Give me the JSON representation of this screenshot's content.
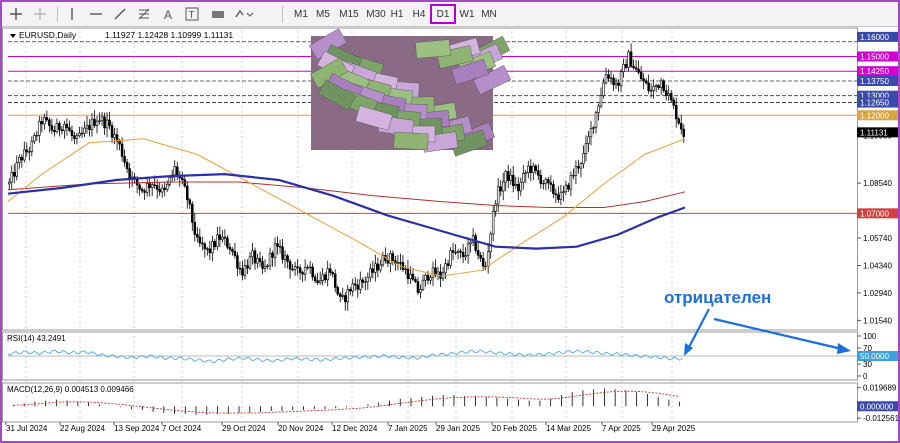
{
  "toolbar": {
    "timeframes": [
      "M1",
      "M5",
      "M15",
      "M30",
      "H1",
      "H4",
      "D1",
      "W1",
      "MN"
    ],
    "active_timeframe": "D1"
  },
  "colors": {
    "candle": "#000000",
    "ma_short": "#e6a040",
    "ma_mid": "#2b2fa8",
    "ma_long": "#b03030",
    "rsi": "#3ea0d8",
    "macd": "#000000",
    "signal": "#d03030",
    "level_magenta": "#d000d0",
    "level_gold": "#d6a640",
    "level_red": "#d04040",
    "annotation": "#1a6fe0",
    "accent": "#a349c4"
  },
  "chart_data": {
    "type": "candlestick",
    "title": "EURUSD,Daily",
    "ohlc_label": "1.11927 1.12428 1.10999 1.11131",
    "current_price": "1.11131",
    "ylim": [
      1.0105,
      1.163
    ],
    "price_ticks": [
      "1.16000",
      "1.13750",
      "1.13000",
      "1.12650",
      "1.10980",
      "1.08540",
      "1.05740",
      "1.04340",
      "1.02940",
      "1.01540"
    ],
    "level_labels": [
      "1.15000",
      "1.14250",
      "1.12000",
      "1.07000"
    ],
    "levels": [
      {
        "value": 1.15,
        "color": "magenta"
      },
      {
        "value": 1.1425,
        "color": "magenta"
      },
      {
        "value": 1.12,
        "color": "gold"
      },
      {
        "value": 1.07,
        "color": "red"
      }
    ],
    "dashed_levels": [
      1.1575,
      1.1375,
      1.13,
      1.1265
    ],
    "x_labels": [
      "31 Jul 2024",
      "22 Aug 2024",
      "13 Sep 2024",
      "7 Oct 2024",
      "29 Oct 2024",
      "20 Nov 2024",
      "12 Dec 2024",
      "7 Jan 2025",
      "29 Jan 2025",
      "20 Feb 2025",
      "14 Mar 2025",
      "7 Apr 2025",
      "29 Apr 2025"
    ],
    "close_path": [
      1.085,
      1.098,
      1.104,
      1.118,
      1.112,
      1.116,
      1.106,
      1.113,
      1.119,
      1.115,
      1.104,
      1.088,
      1.082,
      1.086,
      1.08,
      1.093,
      1.08,
      1.055,
      1.05,
      1.058,
      1.053,
      1.04,
      1.048,
      1.04,
      1.053,
      1.047,
      1.039,
      1.044,
      1.035,
      1.042,
      1.024,
      1.033,
      1.035,
      1.041,
      1.048,
      1.046,
      1.04,
      1.03,
      1.04,
      1.038,
      1.05,
      1.048,
      1.056,
      1.04,
      1.078,
      1.09,
      1.082,
      1.094,
      1.088,
      1.082,
      1.078,
      1.09,
      1.1,
      1.12,
      1.142,
      1.135,
      1.15,
      1.14,
      1.132,
      1.138,
      1.125,
      1.111
    ],
    "ma_short": [
      [
        0,
        1.076
      ],
      [
        0.05,
        1.09
      ],
      [
        0.12,
        1.106
      ],
      [
        0.2,
        1.108
      ],
      [
        0.28,
        1.1
      ],
      [
        0.36,
        1.085
      ],
      [
        0.44,
        1.07
      ],
      [
        0.52,
        1.055
      ],
      [
        0.58,
        1.043
      ],
      [
        0.64,
        1.038
      ],
      [
        0.7,
        1.041
      ],
      [
        0.76,
        1.055
      ],
      [
        0.82,
        1.068
      ],
      [
        0.88,
        1.085
      ],
      [
        0.94,
        1.1
      ],
      [
        1.0,
        1.108
      ]
    ],
    "ma_mid": [
      [
        0,
        1.08
      ],
      [
        0.08,
        1.083
      ],
      [
        0.16,
        1.087
      ],
      [
        0.24,
        1.089
      ],
      [
        0.32,
        1.09
      ],
      [
        0.4,
        1.087
      ],
      [
        0.48,
        1.079
      ],
      [
        0.56,
        1.069
      ],
      [
        0.64,
        1.061
      ],
      [
        0.72,
        1.053
      ],
      [
        0.78,
        1.052
      ],
      [
        0.84,
        1.053
      ],
      [
        0.9,
        1.059
      ],
      [
        0.96,
        1.068
      ],
      [
        1.0,
        1.073
      ]
    ],
    "ma_long": [
      [
        0,
        1.082
      ],
      [
        0.12,
        1.085
      ],
      [
        0.24,
        1.086
      ],
      [
        0.34,
        1.086
      ],
      [
        0.44,
        1.083
      ],
      [
        0.54,
        1.079
      ],
      [
        0.64,
        1.076
      ],
      [
        0.72,
        1.074
      ],
      [
        0.8,
        1.073
      ],
      [
        0.88,
        1.073
      ],
      [
        0.94,
        1.076
      ],
      [
        1.0,
        1.081
      ]
    ],
    "rsi": {
      "label": "RSI(14) 43.2491",
      "ticks": [
        "100",
        "70",
        "30",
        "0"
      ],
      "level_label": "50.0000",
      "ylim": [
        0,
        100
      ],
      "values": [
        55,
        60,
        57,
        62,
        58,
        60,
        52,
        48,
        46,
        50,
        45,
        44,
        40,
        36,
        42,
        45,
        40,
        38,
        44,
        42,
        40,
        44,
        46,
        48,
        50,
        46,
        45,
        52,
        55,
        60,
        62,
        58,
        55,
        52,
        54,
        58,
        62,
        60,
        56,
        54,
        50,
        48,
        44,
        43
      ]
    },
    "macd": {
      "label": "MACD(12,26,9) 0.004513 0.009466",
      "ticks": [
        "0.019689",
        "0.000000",
        "-0.012561"
      ],
      "ylim": [
        -0.0135,
        0.0215
      ],
      "hist": [
        0.001,
        0.003,
        0.005,
        0.006,
        0.007,
        0.006,
        0.005,
        0.004,
        0.002,
        0,
        -0.001,
        -0.003,
        -0.004,
        -0.006,
        -0.007,
        -0.008,
        -0.008,
        -0.009,
        -0.009,
        -0.008,
        -0.008,
        -0.007,
        -0.007,
        -0.006,
        -0.005,
        -0.005,
        -0.004,
        -0.004,
        -0.003,
        -0.003,
        -0.002,
        -0.001,
        0,
        0.002,
        0.004,
        0.006,
        0.008,
        0.009,
        0.01,
        0.011,
        0.012,
        0.012,
        0.011,
        0.011,
        0.01,
        0.009,
        0.008,
        0.007,
        0.006,
        0.006,
        0.008,
        0.012,
        0.015,
        0.017,
        0.018,
        0.019,
        0.018,
        0.017,
        0.015,
        0.013,
        0.01,
        0.007,
        0.005
      ]
    }
  },
  "annotation": {
    "text": "отрицателен"
  }
}
